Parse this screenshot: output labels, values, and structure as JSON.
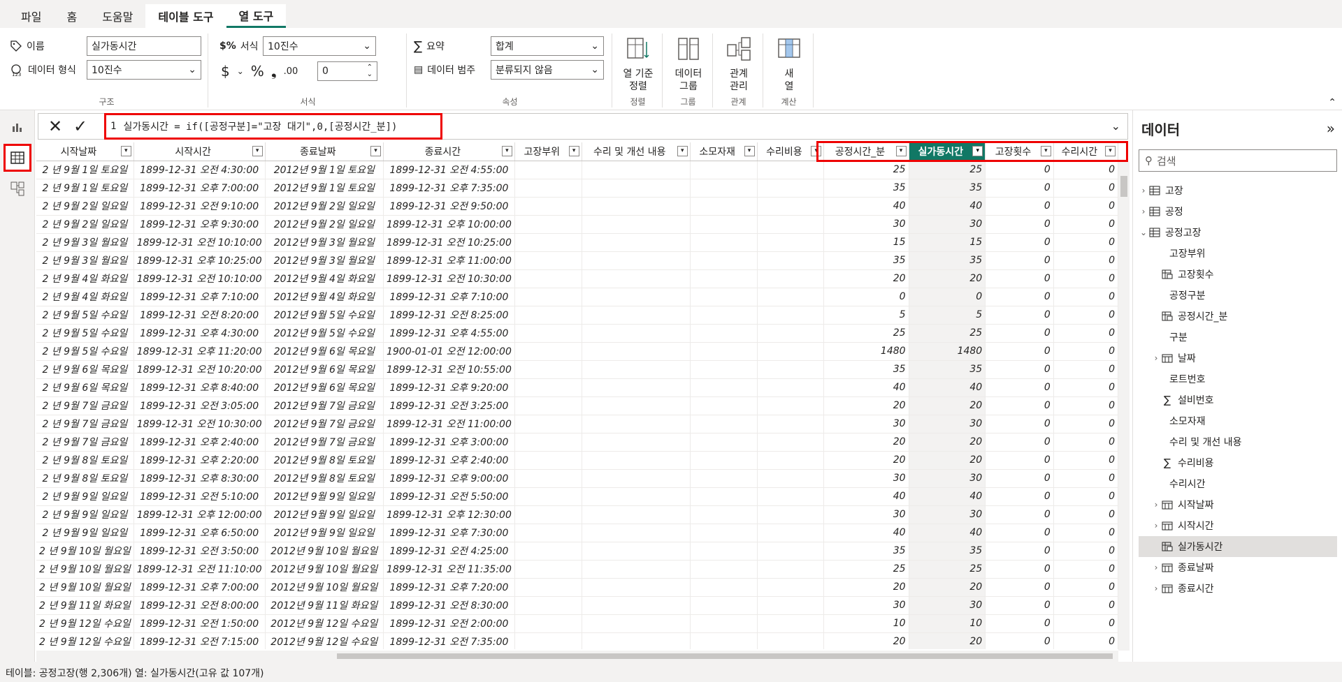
{
  "tabs": [
    "파일",
    "홈",
    "도움말",
    "테이블 도구",
    "열 도구"
  ],
  "ribbon": {
    "name_label": "이름",
    "name_value": "실가동시간",
    "datatype_label": "데이터 형식",
    "datatype_value": "10진수",
    "structure_label": "구조",
    "format_label": "서식",
    "format_value": "10진수",
    "currency": "$",
    "percent": "%",
    "comma": "❟",
    "decimals_value": "0",
    "format_group": "서식",
    "summary_label": "요약",
    "summary_value": "합계",
    "category_label": "데이터 범주",
    "category_value": "분류되지 않음",
    "props_group": "속성",
    "sort_btn_l1": "열 기준",
    "sort_btn_l2": "정렬",
    "sort_group": "정렬",
    "group_btn_l1": "데이터",
    "group_btn_l2": "그룹",
    "group_group": "그룹",
    "rel_btn_l1": "관계",
    "rel_btn_l2": "관리",
    "rel_group": "관계",
    "new_btn_l1": "새",
    "new_btn_l2": "열",
    "calc_group": "계산"
  },
  "formula": {
    "line": "1",
    "text": "실가동시간 = if([공정구분]=\"고장 대기\",0,[공정시간_분])"
  },
  "table": {
    "columns": [
      "시작날짜",
      "시작시간",
      "종료날짜",
      "종료시간",
      "고장부위",
      "수리 및 개선 내용",
      "소모자재",
      "수리비용",
      "공정시간_분",
      "실가동시간",
      "고장횟수",
      "수리시간"
    ],
    "rows": [
      [
        "2 년 9월 1일 토요일",
        "1899-12-31 오전 4:30:00",
        "2012년 9월 1일 토요일",
        "1899-12-31 오전 4:55:00",
        "25",
        "25",
        "0",
        "0"
      ],
      [
        "2 년 9월 1일 토요일",
        "1899-12-31 오후 7:00:00",
        "2012년 9월 1일 토요일",
        "1899-12-31 오후 7:35:00",
        "35",
        "35",
        "0",
        "0"
      ],
      [
        "2 년 9월 2일 일요일",
        "1899-12-31 오전 9:10:00",
        "2012년 9월 2일 일요일",
        "1899-12-31 오전 9:50:00",
        "40",
        "40",
        "0",
        "0"
      ],
      [
        "2 년 9월 2일 일요일",
        "1899-12-31 오후 9:30:00",
        "2012년 9월 2일 일요일",
        "1899-12-31 오후 10:00:00",
        "30",
        "30",
        "0",
        "0"
      ],
      [
        "2 년 9월 3일 월요일",
        "1899-12-31 오전 10:10:00",
        "2012년 9월 3일 월요일",
        "1899-12-31 오전 10:25:00",
        "15",
        "15",
        "0",
        "0"
      ],
      [
        "2 년 9월 3일 월요일",
        "1899-12-31 오후 10:25:00",
        "2012년 9월 3일 월요일",
        "1899-12-31 오후 11:00:00",
        "35",
        "35",
        "0",
        "0"
      ],
      [
        "2 년 9월 4일 화요일",
        "1899-12-31 오전 10:10:00",
        "2012년 9월 4일 화요일",
        "1899-12-31 오전 10:30:00",
        "20",
        "20",
        "0",
        "0"
      ],
      [
        "2 년 9월 4일 화요일",
        "1899-12-31 오후 7:10:00",
        "2012년 9월 4일 화요일",
        "1899-12-31 오후 7:10:00",
        "0",
        "0",
        "0",
        "0"
      ],
      [
        "2 년 9월 5일 수요일",
        "1899-12-31 오전 8:20:00",
        "2012년 9월 5일 수요일",
        "1899-12-31 오전 8:25:00",
        "5",
        "5",
        "0",
        "0"
      ],
      [
        "2 년 9월 5일 수요일",
        "1899-12-31 오후 4:30:00",
        "2012년 9월 5일 수요일",
        "1899-12-31 오후 4:55:00",
        "25",
        "25",
        "0",
        "0"
      ],
      [
        "2 년 9월 5일 수요일",
        "1899-12-31 오후 11:20:00",
        "2012년 9월 6일 목요일",
        "1900-01-01 오전 12:00:00",
        "1480",
        "1480",
        "0",
        "0"
      ],
      [
        "2 년 9월 6일 목요일",
        "1899-12-31 오전 10:20:00",
        "2012년 9월 6일 목요일",
        "1899-12-31 오전 10:55:00",
        "35",
        "35",
        "0",
        "0"
      ],
      [
        "2 년 9월 6일 목요일",
        "1899-12-31 오후 8:40:00",
        "2012년 9월 6일 목요일",
        "1899-12-31 오후 9:20:00",
        "40",
        "40",
        "0",
        "0"
      ],
      [
        "2 년 9월 7일 금요일",
        "1899-12-31 오전 3:05:00",
        "2012년 9월 7일 금요일",
        "1899-12-31 오전 3:25:00",
        "20",
        "20",
        "0",
        "0"
      ],
      [
        "2 년 9월 7일 금요일",
        "1899-12-31 오전 10:30:00",
        "2012년 9월 7일 금요일",
        "1899-12-31 오전 11:00:00",
        "30",
        "30",
        "0",
        "0"
      ],
      [
        "2 년 9월 7일 금요일",
        "1899-12-31 오후 2:40:00",
        "2012년 9월 7일 금요일",
        "1899-12-31 오후 3:00:00",
        "20",
        "20",
        "0",
        "0"
      ],
      [
        "2 년 9월 8일 토요일",
        "1899-12-31 오후 2:20:00",
        "2012년 9월 8일 토요일",
        "1899-12-31 오후 2:40:00",
        "20",
        "20",
        "0",
        "0"
      ],
      [
        "2 년 9월 8일 토요일",
        "1899-12-31 오후 8:30:00",
        "2012년 9월 8일 토요일",
        "1899-12-31 오후 9:00:00",
        "30",
        "30",
        "0",
        "0"
      ],
      [
        "2 년 9월 9일 일요일",
        "1899-12-31 오전 5:10:00",
        "2012년 9월 9일 일요일",
        "1899-12-31 오전 5:50:00",
        "40",
        "40",
        "0",
        "0"
      ],
      [
        "2 년 9월 9일 일요일",
        "1899-12-31 오후 12:00:00",
        "2012년 9월 9일 일요일",
        "1899-12-31 오후 12:30:00",
        "30",
        "30",
        "0",
        "0"
      ],
      [
        "2 년 9월 9일 일요일",
        "1899-12-31 오후 6:50:00",
        "2012년 9월 9일 일요일",
        "1899-12-31 오후 7:30:00",
        "40",
        "40",
        "0",
        "0"
      ],
      [
        "2 년 9월 10일 월요일",
        "1899-12-31 오전 3:50:00",
        "2012년 9월 10일 월요일",
        "1899-12-31 오전 4:25:00",
        "35",
        "35",
        "0",
        "0"
      ],
      [
        "2 년 9월 10일 월요일",
        "1899-12-31 오전 11:10:00",
        "2012년 9월 10일 월요일",
        "1899-12-31 오전 11:35:00",
        "25",
        "25",
        "0",
        "0"
      ],
      [
        "2 년 9월 10일 월요일",
        "1899-12-31 오후 7:00:00",
        "2012년 9월 10일 월요일",
        "1899-12-31 오후 7:20:00",
        "20",
        "20",
        "0",
        "0"
      ],
      [
        "2 년 9월 11일 화요일",
        "1899-12-31 오전 8:00:00",
        "2012년 9월 11일 화요일",
        "1899-12-31 오전 8:30:00",
        "30",
        "30",
        "0",
        "0"
      ],
      [
        "2 년 9월 12일 수요일",
        "1899-12-31 오전 1:50:00",
        "2012년 9월 12일 수요일",
        "1899-12-31 오전 2:00:00",
        "10",
        "10",
        "0",
        "0"
      ],
      [
        "2 년 9월 12일 수요일",
        "1899-12-31 오전 7:15:00",
        "2012년 9월 12일 수요일",
        "1899-12-31 오전 7:35:00",
        "20",
        "20",
        "0",
        "0"
      ]
    ]
  },
  "pane": {
    "title": "데이터",
    "search_placeholder": "검색",
    "items": [
      {
        "label": "고장",
        "icon": "table-icon",
        "chev": "›",
        "indent": 0
      },
      {
        "label": "공정",
        "icon": "table-icon",
        "chev": "›",
        "indent": 0
      },
      {
        "label": "공정고장",
        "icon": "table-icon",
        "chev": "⌄",
        "indent": 0
      },
      {
        "label": "고장부위",
        "icon": "",
        "chev": "",
        "indent": 2
      },
      {
        "label": "고장횟수",
        "icon": "calc-column-icon",
        "chev": "",
        "indent": 1
      },
      {
        "label": "공정구분",
        "icon": "",
        "chev": "",
        "indent": 2
      },
      {
        "label": "공정시간_분",
        "icon": "calc-column-icon",
        "chev": "",
        "indent": 1
      },
      {
        "label": "구분",
        "icon": "",
        "chev": "",
        "indent": 2
      },
      {
        "label": "날짜",
        "icon": "calendar-icon",
        "chev": "›",
        "indent": 1
      },
      {
        "label": "로트번호",
        "icon": "",
        "chev": "",
        "indent": 2
      },
      {
        "label": "설비번호",
        "icon": "sigma-icon",
        "chev": "",
        "indent": 1
      },
      {
        "label": "소모자재",
        "icon": "",
        "chev": "",
        "indent": 2
      },
      {
        "label": "수리 및 개선 내용",
        "icon": "",
        "chev": "",
        "indent": 2
      },
      {
        "label": "수리비용",
        "icon": "sigma-icon",
        "chev": "",
        "indent": 1
      },
      {
        "label": "수리시간",
        "icon": "",
        "chev": "",
        "indent": 2
      },
      {
        "label": "시작날짜",
        "icon": "calendar-icon",
        "chev": "›",
        "indent": 1
      },
      {
        "label": "시작시간",
        "icon": "calendar-icon",
        "chev": "›",
        "indent": 1
      },
      {
        "label": "실가동시간",
        "icon": "calc-column-icon",
        "chev": "",
        "indent": 1,
        "selected": true
      },
      {
        "label": "종료날짜",
        "icon": "calendar-icon",
        "chev": "›",
        "indent": 1
      },
      {
        "label": "종료시간",
        "icon": "calendar-icon",
        "chev": "›",
        "indent": 1
      }
    ]
  },
  "status": "테이블: 공정고장(행 2,306개) 열: 실가동시간(고유 값 107개)",
  "colors": {
    "accent": "#117865",
    "highlight": "#ee0000"
  }
}
